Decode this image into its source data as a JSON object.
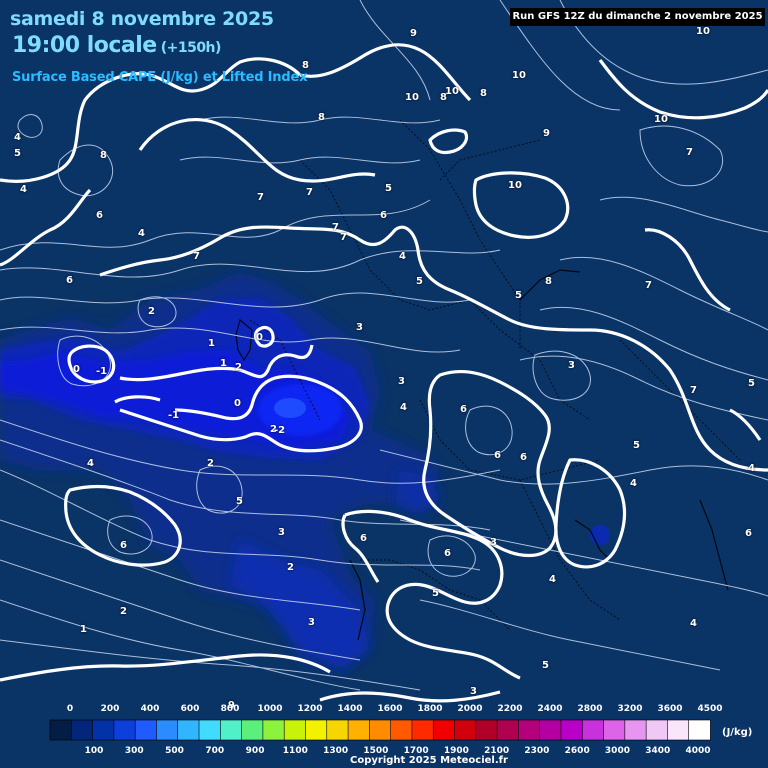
{
  "title": {
    "date": "samedi 8 novembre 2025",
    "hour": "19:00 locale",
    "lead_time": "(+150h)",
    "parameter": "Surface Based CAPE (J/kg) et Lifted Index"
  },
  "run_info": "Run GFS 12Z du dimanche 2 novembre 2025",
  "legend": {
    "unit": "(J/kg)",
    "top_labels": [
      "0",
      "200",
      "400",
      "600",
      "800",
      "1000",
      "1200",
      "1400",
      "1600",
      "1800",
      "2000",
      "2200",
      "2400",
      "2800",
      "3200",
      "3600",
      "4500"
    ],
    "bottom_labels": [
      "100",
      "300",
      "500",
      "700",
      "900",
      "1100",
      "1300",
      "1500",
      "1700",
      "1900",
      "2100",
      "2300",
      "2600",
      "3000",
      "3400",
      "4000"
    ],
    "colors": [
      "#031d45",
      "#02267a",
      "#0332a8",
      "#0d3fdc",
      "#1f5bff",
      "#2b8cff",
      "#2fb6ff",
      "#3fdcff",
      "#50f0c8",
      "#5bf07c",
      "#8cf23c",
      "#c8f20a",
      "#f2f200",
      "#f5d600",
      "#ffb000",
      "#ff8c00",
      "#ff5a00",
      "#ff2a00",
      "#f00000",
      "#d0000c",
      "#b0002a",
      "#b00050",
      "#b4007a",
      "#b400a0",
      "#b800c8",
      "#c832dc",
      "#dc64e6",
      "#e696f0",
      "#f0c8f5",
      "#fae6fa",
      "#ffffff"
    ]
  },
  "copyright": "Copyright 2025 Meteociel.fr",
  "lifted_index_labels": [
    "10",
    "10",
    "10",
    "10",
    "10",
    "10",
    "9",
    "9",
    "9",
    "8",
    "8",
    "8",
    "8",
    "8",
    "8",
    "7",
    "7",
    "7",
    "7",
    "7",
    "7",
    "7",
    "7",
    "6",
    "6",
    "6",
    "6",
    "6",
    "6",
    "6",
    "6",
    "6",
    "6",
    "5",
    "5",
    "5",
    "5",
    "5",
    "5",
    "5",
    "5",
    "5",
    "4",
    "4",
    "4",
    "4",
    "4",
    "4",
    "4",
    "4",
    "4",
    "4",
    "3",
    "3",
    "3",
    "3",
    "3",
    "3",
    "3",
    "2",
    "2",
    "2",
    "2",
    "2",
    "2",
    "1",
    "1",
    "1",
    "0",
    "0",
    "0",
    "-1",
    "-1",
    "-2"
  ]
}
